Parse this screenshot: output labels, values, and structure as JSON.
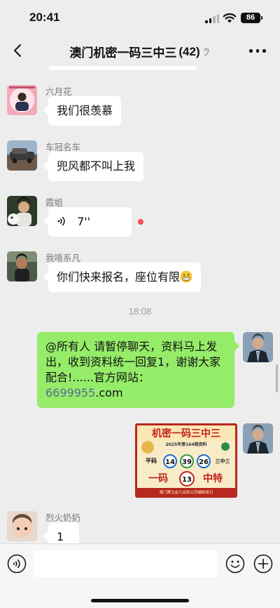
{
  "status_bar": {
    "time": "20:41",
    "battery": "86"
  },
  "nav": {
    "title": "澳门机密一码三中三",
    "member_count": "(42)"
  },
  "messages": [
    {
      "type": "text",
      "sender": "六月花",
      "text": "我们很羡慕"
    },
    {
      "type": "text",
      "sender": "车冠名车",
      "text": "兜风都不叫上我"
    },
    {
      "type": "voice",
      "sender": "霞姐",
      "duration": "7''"
    },
    {
      "type": "text",
      "sender": "我唔系凡",
      "text": "你们快来报名，座位有限"
    },
    {
      "type": "time",
      "text": "18:08"
    },
    {
      "type": "text",
      "sender": "self",
      "text_parts": [
        "@所有人 请暂停聊天，资料马上发出，收到资料统一回复1，谢谢大家配合!......官方网站：",
        "6699955",
        ".com"
      ]
    },
    {
      "type": "image",
      "sender": "self"
    },
    {
      "type": "text",
      "sender": "烈火奶奶",
      "text": "1"
    }
  ],
  "poster": {
    "title": "机密一码三中三",
    "subtitle": "2025年第164期资料",
    "left_label": "平码",
    "right_label": "三中三",
    "numbers": [
      "14",
      "39",
      "26"
    ],
    "bottom_left": "一码",
    "special_number": "13",
    "bottom_right": "中特",
    "footer": "澳门赛马会六合彩公司编制发行"
  },
  "colors": {
    "chat_bg": "#ededed",
    "self_bubble": "#95ec69",
    "link": "#576b95",
    "unread": "#f54d4d",
    "poster_red": "#b7281e"
  }
}
